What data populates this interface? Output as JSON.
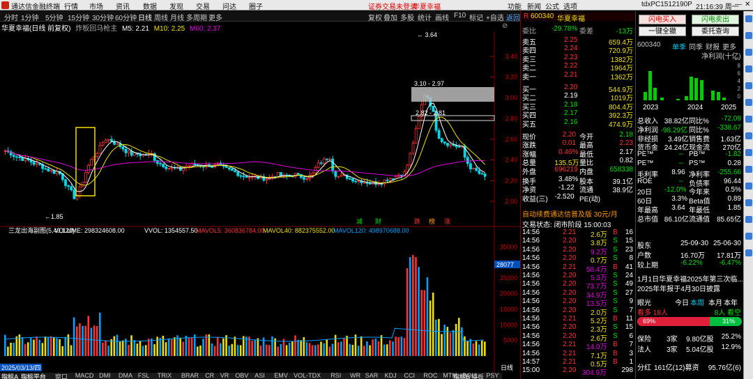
{
  "menu": {
    "app_title": "通达信金融终端",
    "items": [
      "行情",
      "市场",
      "资讯",
      "数据",
      "发现",
      "交易",
      "问达",
      "圈子"
    ],
    "alert": "证券交易未登录",
    "stock_name": "华夏幸福",
    "right_items": [
      "功能",
      "新闻",
      "公式",
      "选项"
    ],
    "account": "tdxPC1512190P",
    "time": "21:16:39 周一"
  },
  "toolbar": {
    "periods": [
      "分时",
      "1分钟",
      "5分钟",
      "15分钟",
      "30分钟",
      "60分钟",
      "日线",
      "周线",
      "月线",
      "多周期",
      "更多"
    ],
    "selected": "日线",
    "tools": [
      "复权",
      "叠加",
      "多股",
      "统计",
      "画线",
      "F10",
      "标记",
      "+自选",
      "返回"
    ]
  },
  "chart_info": {
    "title": "华夏幸福(日线 前复权)",
    "indicator": "炸板回马枪主",
    "ma5": "M5: 2.21",
    "ma10": "M10: 2.25",
    "ma60": "M60: 2.37"
  },
  "price_axis": [
    "3.40",
    "3.20",
    "3.00",
    "2.80",
    "2.60",
    "2.40",
    "2.20",
    "2.00"
  ],
  "annotations": {
    "high": "3.64",
    "low": "1.85",
    "box1": "3.10 - 2.97",
    "box2": "2.82 - 2.81"
  },
  "markers": [
    "减",
    "财",
    "跌",
    "榜",
    "涨"
  ],
  "vol_info": {
    "name": "三龙出海副图(5,40,120)",
    "volume": "VOLUME: 298324608.00",
    "vvol": "VVOL: 1354557.50",
    "mavol5": "MAVOL5: 360836784.00",
    "mavol40": "MAVOL40: 882375552.00",
    "mavol120": "MAVOL120: 498970688.00"
  },
  "vol_axis": [
    "35000",
    "30000",
    "25000",
    "20000",
    "15000",
    "10000",
    "5000"
  ],
  "vol_marker": "28077",
  "date_label": "2025/03/13/四",
  "period_label": "日线",
  "bottom_tabs": [
    "指标A",
    "指标平台",
    "窗口",
    "MACD",
    "DMI",
    "DMA",
    "FSL",
    "TRIX",
    "BRAR",
    "CR",
    "VR",
    "OBV",
    "ASI",
    "EMV",
    "VOL-TDX",
    "RSI",
    "WR",
    "SAR",
    "KDJ",
    "CCI",
    "ROC",
    "MTM",
    "BOLL",
    "PSY",
    "MCST",
    "更多"
  ],
  "bottom_right": [
    "指标B",
    "模板"
  ],
  "quote": {
    "code": "600340",
    "name": "华夏幸福",
    "weibi_label": "委比",
    "weibi": "-29.78%",
    "weicha_label": "委差",
    "weicha": "-13万",
    "asks": [
      {
        "label": "卖五",
        "price": "2.25",
        "vol": "659.4万"
      },
      {
        "label": "卖四",
        "price": "2.24",
        "vol": "720.9万"
      },
      {
        "label": "卖三",
        "price": "2.23",
        "vol": "1382万"
      },
      {
        "label": "卖二",
        "price": "2.22",
        "vol": "1964万"
      },
      {
        "label": "卖一",
        "price": "2.21",
        "vol": "1362万"
      }
    ],
    "bids": [
      {
        "label": "买一",
        "price": "2.20",
        "vol": "544.9万"
      },
      {
        "label": "买二",
        "price": "2.19",
        "vol": "1019万"
      },
      {
        "label": "买三",
        "price": "2.18",
        "vol": "804.4万"
      },
      {
        "label": "买四",
        "price": "2.17",
        "vol": "392.3万"
      },
      {
        "label": "买五",
        "price": "2.16",
        "vol": "474.9万"
      }
    ],
    "stats": [
      [
        "现价",
        "2.20",
        "今开",
        "2.18"
      ],
      [
        "涨跌",
        "0.01",
        "最高",
        "2.23"
      ],
      [
        "涨幅",
        "0.46%",
        "最低",
        "2.17"
      ],
      [
        "总量",
        "135.5万",
        "量比",
        "0.82"
      ],
      [
        "外盘",
        "696219",
        "内盘",
        "658338"
      ],
      [
        "换手",
        "3.48%",
        "股本",
        "39.1亿"
      ],
      [
        "净资",
        "-1.22",
        "流通",
        "38.9亿"
      ],
      [
        "收益(三)",
        "-2.520",
        "PE(动)",
        ""
      ]
    ],
    "ad": "自动续费通达信普及版 30元/月",
    "status": "交易状态: 闭市阶段 15:00:03"
  },
  "ticks": [
    [
      "14:56",
      "2.21",
      "2.6万",
      "B",
      "16"
    ],
    [
      "14:56",
      "2.20",
      "3.8万",
      "S",
      "15"
    ],
    [
      "14:56",
      "2.20",
      "9.2万",
      "S",
      "23"
    ],
    [
      "14:56",
      "2.20",
      "0.7万",
      "S",
      "8"
    ],
    [
      "14:56",
      "2.21",
      "58.4万",
      "B",
      "41"
    ],
    [
      "14:56",
      "2.20",
      "5.3万",
      "S",
      "24"
    ],
    [
      "14:56",
      "2.20",
      "73.7万",
      "S",
      "49"
    ],
    [
      "14:56",
      "2.20",
      "34.9万",
      "S",
      "27"
    ],
    [
      "14:56",
      "2.20",
      "13.5万",
      "S",
      "9"
    ],
    [
      "14:56",
      "2.20",
      "2.0万",
      "S",
      "7"
    ],
    [
      "14:56",
      "2.21",
      "5.2万",
      "B",
      "11"
    ],
    [
      "14:56",
      "2.20",
      "2.3万",
      "S",
      "15"
    ],
    [
      "14:56",
      "2.20",
      "2.6万",
      "S",
      "6"
    ],
    [
      "14:56",
      "2.21",
      "14.0万",
      "B",
      "7"
    ],
    [
      "14:56",
      "2.21",
      "7.1万",
      "B",
      "3"
    ],
    [
      "14:57",
      "2.21",
      "0.5万",
      "B",
      "1"
    ],
    [
      "15:00",
      "2.20",
      "304.9万",
      "",
      "298"
    ]
  ],
  "far": {
    "btn_buy": "闪电买入",
    "btn_sell": "闪电卖出",
    "btn_cancel": "一键全撤",
    "btn_query": "委托查询",
    "code": "600340",
    "tabs": [
      "单季",
      "同季",
      "财报",
      "更多"
    ],
    "profit_title": "净利润(十亿)",
    "profit_axis": [
      "10",
      "8",
      "6",
      "4",
      "2",
      "0"
    ],
    "years": [
      "2023",
      "2024",
      "2025"
    ],
    "fin": [
      [
        "总收入",
        "38.82亿",
        "同比%",
        "-72.09"
      ],
      [
        "净利润",
        "-98.29亿",
        "同比%",
        "-338.67"
      ],
      [
        "非经损",
        "3.49亿",
        "销售费",
        "1.63亿"
      ],
      [
        "货币金",
        "24.24亿",
        "现金流",
        "270亿"
      ],
      [
        "PE™",
        "--",
        "PB™",
        "-1.82"
      ],
      [
        "PE™",
        "--",
        "PS™",
        "0.28"
      ],
      [
        "毛利率",
        "8.96",
        "净利率",
        "-255.66"
      ],
      [
        "ROE",
        "--",
        "负债率",
        "96.44"
      ],
      [
        "20日",
        "-12.0%",
        "今年来",
        "0.5%"
      ],
      [
        "60日",
        "3.3%",
        "Beta值",
        "0.89"
      ],
      [
        "年最高",
        "3.64",
        "年最低",
        "1.85"
      ],
      [
        "总市值",
        "86.10亿",
        "流通值",
        "85.65亿"
      ]
    ],
    "holders": [
      [
        "股东",
        "25-09-30",
        "25-06-30"
      ],
      [
        "户数",
        "16.70万",
        "17.81万"
      ],
      [
        "较上期",
        "-6.22%",
        "-6.47%"
      ]
    ],
    "news": [
      "1月1日华夏幸福2025年第三次临...",
      "2025年年报于4月30日披露"
    ],
    "eye": {
      "label": "眼光",
      "tabs": [
        "今日",
        "本周",
        "本月",
        "本年"
      ],
      "bull": "看多 18人",
      "bear": "8人 看空",
      "bull_pct": "69%",
      "bear_pct": "31%"
    },
    "inst": [
      [
        "保险",
        "3家",
        "9.80亿股",
        "25.2%"
      ],
      [
        "法人",
        "3家",
        "5.04亿股",
        "12.9%"
      ]
    ],
    "dividend": [
      "分红",
      "161亿(12)募资",
      "95.76亿(6)"
    ]
  }
}
